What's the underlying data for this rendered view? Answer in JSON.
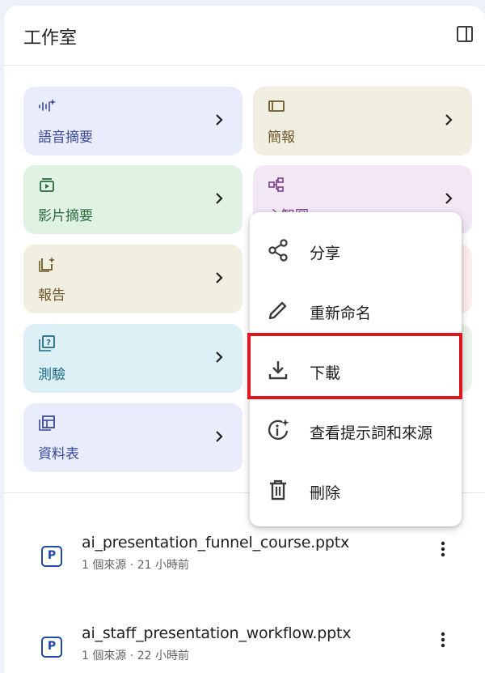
{
  "panel": {
    "title": "工作室"
  },
  "tiles": [
    {
      "label": "語音摘要",
      "icon": "audio-sparkle-icon",
      "bg": "#e9ecfb",
      "fg": "#3b4a9c"
    },
    {
      "label": "簡報",
      "icon": "slides-icon",
      "bg": "#f1efe2",
      "fg": "#6d5a2a"
    },
    {
      "label": "影片摘要",
      "icon": "video-icon",
      "bg": "#e0f2e4",
      "fg": "#2d6a3e"
    },
    {
      "label": "心智圖",
      "icon": "mindmap-icon",
      "bg": "#f1e8f4",
      "fg": "#7a3e86"
    },
    {
      "label": "報告",
      "icon": "report-icon",
      "bg": "#f1efe2",
      "fg": "#6d5a2a"
    },
    {
      "label": "測驗",
      "icon": "quiz-icon",
      "bg": "#dcf0f6",
      "fg": "#1d6a86"
    },
    {
      "label": "資料表",
      "icon": "table-icon",
      "bg": "#e9ecfb",
      "fg": "#3b4a9c"
    }
  ],
  "menu": {
    "items": [
      {
        "label": "分享",
        "icon": "share-icon"
      },
      {
        "label": "重新命名",
        "icon": "pencil-icon"
      },
      {
        "label": "下載",
        "icon": "download-icon"
      },
      {
        "label": "查看提示詞和來源",
        "icon": "info-sparkle-icon"
      },
      {
        "label": "刪除",
        "icon": "trash-icon"
      }
    ],
    "highlighted": "下載"
  },
  "files": [
    {
      "name": "ai_presentation_funnel_course.pptx",
      "meta": "1 個來源 · 21 小時前",
      "icon_letter": "P"
    },
    {
      "name": "ai_staff_presentation_workflow.pptx",
      "meta": "1 個來源 · 22 小時前",
      "icon_letter": "P"
    }
  ],
  "colors": {
    "highlight": "#e0161e",
    "file_icon": "#1f4aa8"
  }
}
